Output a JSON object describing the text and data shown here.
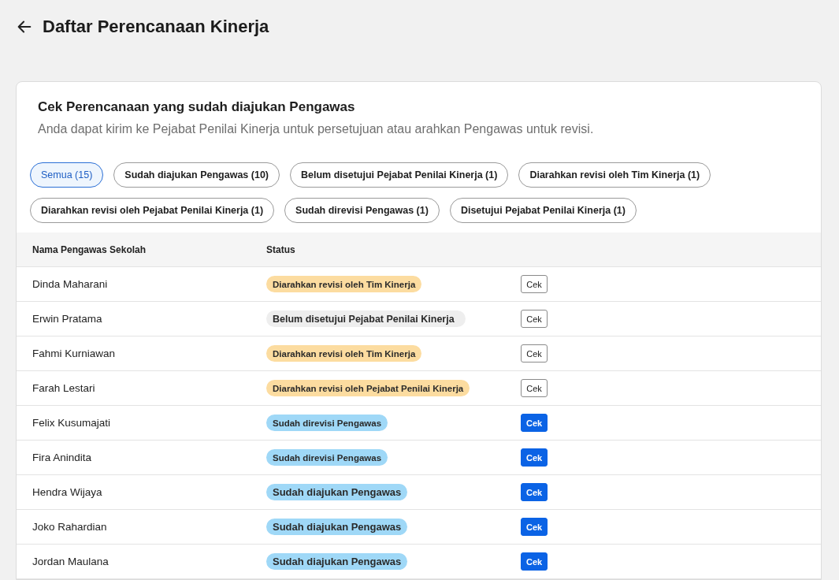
{
  "page": {
    "title": "Daftar Perencanaan Kinerja"
  },
  "card": {
    "title": "Cek Perencanaan yang sudah diajukan Pengawas",
    "subtitle": "Anda dapat kirim ke Pejabat Penilai Kinerja untuk persetujuan atau arahkan Pengawas untuk revisi."
  },
  "filters": [
    {
      "label": "Semua (15)",
      "selected": true
    },
    {
      "label": "Sudah diajukan Pengawas (10)",
      "selected": false
    },
    {
      "label": "Belum disetujui Pejabat Penilai Kinerja (1)",
      "selected": false
    },
    {
      "label": "Diarahkan revisi oleh Tim Kinerja (1)",
      "selected": false
    },
    {
      "label": "Diarahkan revisi oleh Pejabat Penilai Kinerja (1)",
      "selected": false
    },
    {
      "label": "Sudah direvisi Pengawas (1)",
      "selected": false
    },
    {
      "label": "Disetujui Pejabat Penilai Kinerja (1)",
      "selected": false
    }
  ],
  "table": {
    "columns": [
      "Nama Pengawas Sekolah",
      "Status"
    ],
    "rows": [
      {
        "name": "Dinda Maharani",
        "status": "Diarahkan revisi oleh Tim Kinerja",
        "kind": "revision",
        "action": "Cek",
        "primary": false
      },
      {
        "name": "Erwin Pratama",
        "status": "Belum disetujui Pejabat Penilai Kinerja",
        "kind": "pending",
        "action": "Cek",
        "primary": false
      },
      {
        "name": "Fahmi Kurniawan",
        "status": "Diarahkan revisi oleh Tim Kinerja",
        "kind": "revision",
        "action": "Cek",
        "primary": false
      },
      {
        "name": "Farah Lestari",
        "status": "Diarahkan revisi oleh Pejabat Penilai Kinerja",
        "kind": "revision",
        "action": "Cek",
        "primary": false
      },
      {
        "name": "Felix Kusumajati",
        "status": "Sudah direvisi Pengawas",
        "kind": "revised",
        "action": "Cek",
        "primary": true
      },
      {
        "name": "Fira Anindita",
        "status": "Sudah direvisi Pengawas",
        "kind": "revised",
        "action": "Cek",
        "primary": true
      },
      {
        "name": "Hendra Wijaya",
        "status": "Sudah diajukan Pengawas",
        "kind": "submitted",
        "action": "Cek",
        "primary": true
      },
      {
        "name": "Joko Rahardian",
        "status": "Sudah diajukan Pengawas",
        "kind": "submitted",
        "action": "Cek",
        "primary": true
      },
      {
        "name": "Jordan Maulana",
        "status": "Sudah diajukan Pengawas",
        "kind": "submitted",
        "action": "Cek",
        "primary": true
      }
    ]
  }
}
